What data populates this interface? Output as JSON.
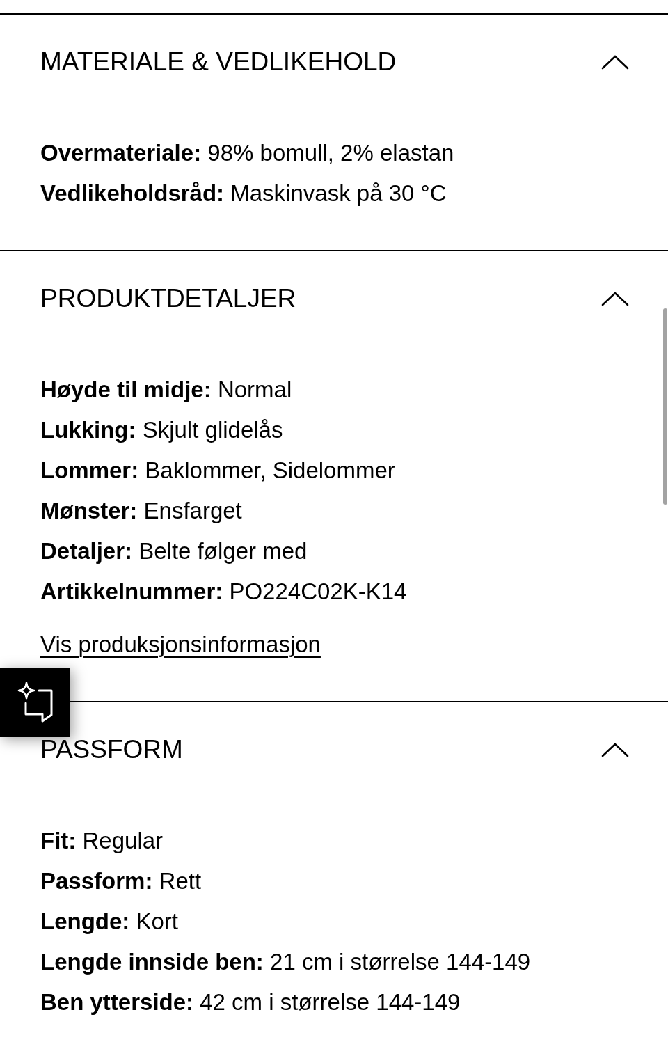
{
  "sections": [
    {
      "title": "MATERIALE & VEDLIKEHOLD",
      "expanded": true,
      "details": [
        {
          "label": "Overmateriale:",
          "value": "98% bomull, 2% elastan"
        },
        {
          "label": "Vedlikeholdsråd:",
          "value": "Maskinvask på 30 °C"
        }
      ]
    },
    {
      "title": "PRODUKTDETALJER",
      "expanded": true,
      "details": [
        {
          "label": "Høyde til midje:",
          "value": "Normal"
        },
        {
          "label": "Lukking:",
          "value": "Skjult glidelås"
        },
        {
          "label": "Lommer:",
          "value": "Baklommer, Sidelommer"
        },
        {
          "label": "Mønster:",
          "value": "Ensfarget"
        },
        {
          "label": "Detaljer:",
          "value": "Belte følger med"
        },
        {
          "label": "Artikkelnummer:",
          "value": "PO224C02K-K14"
        }
      ],
      "link": "Vis produksjonsinformasjon"
    },
    {
      "title": "PASSFORM",
      "expanded": true,
      "details": [
        {
          "label": "Fit:",
          "value": "Regular"
        },
        {
          "label": "Passform:",
          "value": "Rett"
        },
        {
          "label": "Lengde:",
          "value": "Kort"
        },
        {
          "label": "Lengde innside ben:",
          "value": "21 cm i størrelse 144-149"
        },
        {
          "label": "Ben ytterside:",
          "value": "42 cm i størrelse 144-149"
        }
      ]
    }
  ]
}
